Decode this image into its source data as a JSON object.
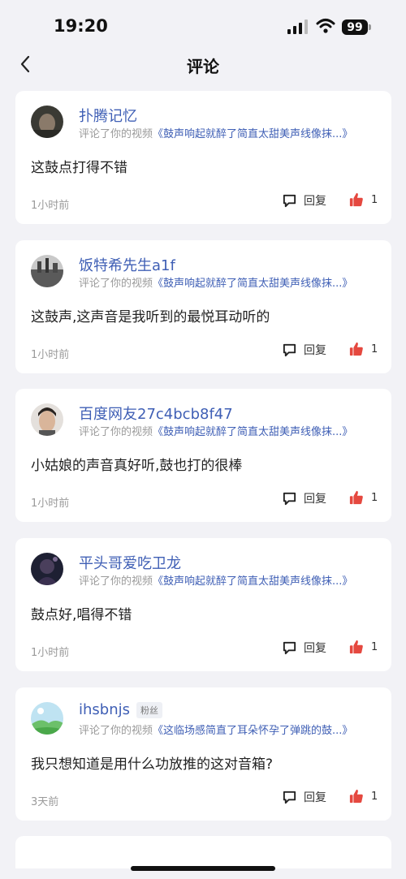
{
  "status_bar": {
    "time": "19:20",
    "battery": "99"
  },
  "header": {
    "title": "评论"
  },
  "comments": [
    {
      "user": "扑腾记忆",
      "badge": "",
      "prefix": "评论了你的视频",
      "video": "《鼓声响起就醉了简直太甜美声线像抹...》",
      "text": "这鼓点打得不错",
      "time": "1小时前",
      "reply": "回复",
      "likes": "1"
    },
    {
      "user": "饭特希先生a1f",
      "badge": "",
      "prefix": "评论了你的视频",
      "video": "《鼓声响起就醉了简直太甜美声线像抹...》",
      "text": "这鼓声,这声音是我听到的最悦耳动听的",
      "time": "1小时前",
      "reply": "回复",
      "likes": "1"
    },
    {
      "user": "百度网友27c4bcb8f47",
      "badge": "",
      "prefix": "评论了你的视频",
      "video": "《鼓声响起就醉了简直太甜美声线像抹...》",
      "text": "小姑娘的声音真好听,鼓也打的很棒",
      "time": "1小时前",
      "reply": "回复",
      "likes": "1"
    },
    {
      "user": "平头哥爱吃卫龙",
      "badge": "",
      "prefix": "评论了你的视频",
      "video": "《鼓声响起就醉了简直太甜美声线像抹...》",
      "text": "鼓点好,唱得不错",
      "time": "1小时前",
      "reply": "回复",
      "likes": "1"
    },
    {
      "user": "ihsbnjs",
      "badge": "粉丝",
      "prefix": "评论了你的视频",
      "video": "《这临场感简直了耳朵怀孕了弹跳的鼓...》",
      "text": "我只想知道是用什么功放推的这对音箱?",
      "time": "3天前",
      "reply": "回复",
      "likes": "1"
    }
  ],
  "colors": {
    "accent": "#3f5fb5",
    "like": "#e5483f",
    "background": "#f2f2f6"
  }
}
